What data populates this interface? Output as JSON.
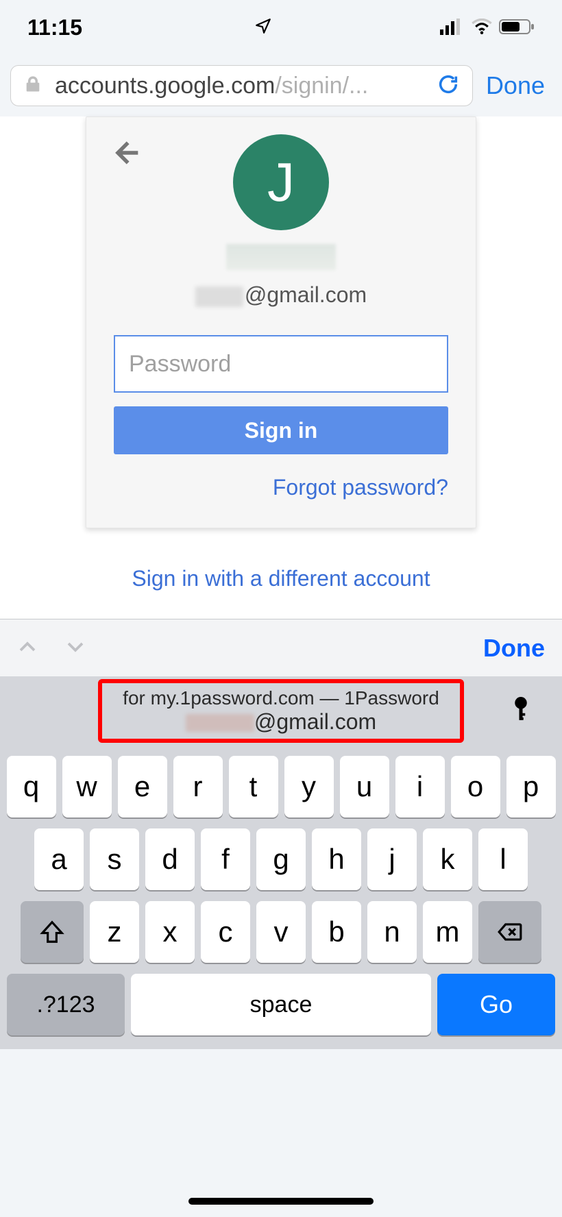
{
  "status": {
    "time": "11:15"
  },
  "browser": {
    "url_host": "accounts.google.com",
    "url_path": "/signin/...",
    "done_label": "Done"
  },
  "signin": {
    "avatar_initial": "J",
    "email_suffix": "@gmail.com",
    "password_placeholder": "Password",
    "signin_label": "Sign in",
    "forgot_label": "Forgot password?",
    "different_account_label": "Sign in with a different account"
  },
  "kb_accessory": {
    "done_label": "Done"
  },
  "autofill": {
    "line1": "for my.1password.com — 1Password",
    "line2_suffix": "@gmail.com"
  },
  "keyboard": {
    "row1": [
      "q",
      "w",
      "e",
      "r",
      "t",
      "y",
      "u",
      "i",
      "o",
      "p"
    ],
    "row2": [
      "a",
      "s",
      "d",
      "f",
      "g",
      "h",
      "j",
      "k",
      "l"
    ],
    "row3": [
      "z",
      "x",
      "c",
      "v",
      "b",
      "n",
      "m"
    ],
    "numbers_label": ".?123",
    "space_label": "space",
    "go_label": "Go"
  }
}
